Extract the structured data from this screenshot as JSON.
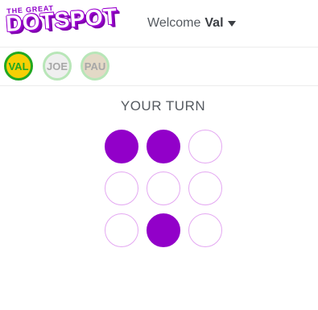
{
  "logo": {
    "line1": "THE GREAT",
    "line2": "DOTSPOT"
  },
  "header": {
    "welcome": "Welcome",
    "user": "Val"
  },
  "players": [
    {
      "name": "VAL",
      "active": true,
      "bg": "#f6cf05",
      "border": "#21a821",
      "color": "#21a821"
    },
    {
      "name": "JOE",
      "active": false,
      "bg": "#efefef",
      "border": "#b8e6b8",
      "color": "#a7a7a7"
    },
    {
      "name": "PAU",
      "active": false,
      "bg": "#e3d9c6",
      "border": "#b8e6b8",
      "color": "#a7a7a7"
    }
  ],
  "turn_label": "YOUR TURN",
  "grid": {
    "rows": 3,
    "cols": 3,
    "cells": [
      true,
      true,
      false,
      false,
      false,
      false,
      false,
      true,
      false
    ]
  },
  "colors": {
    "dot_filled": "#9200c9",
    "dot_empty_border": "#e4a8f2"
  }
}
